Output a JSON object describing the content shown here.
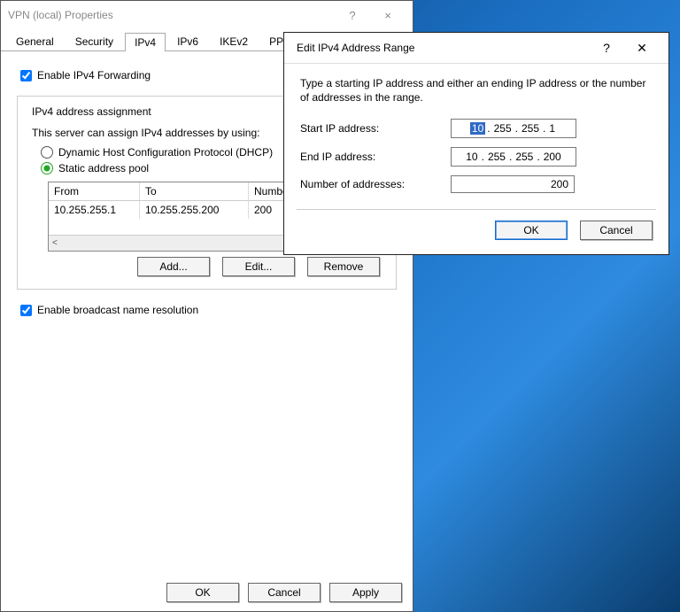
{
  "prop": {
    "title": "VPN (local) Properties",
    "help": "?",
    "close": "×",
    "tabs": [
      "General",
      "Security",
      "IPv4",
      "IPv6",
      "IKEv2",
      "PPP"
    ],
    "activeTab": "IPv4",
    "enableForwarding": "Enable IPv4 Forwarding",
    "groupTitle": "IPv4 address assignment",
    "groupDesc": "This server can assign IPv4 addresses by using:",
    "radioDhcp": "Dynamic Host Configuration Protocol (DHCP)",
    "radioStatic": "Static address pool",
    "tableHdr": {
      "from": "From",
      "to": "To",
      "number": "Number"
    },
    "tableRow": {
      "from": "10.255.255.1",
      "to": "10.255.255.200",
      "number": "200"
    },
    "btnAdd": "Add...",
    "btnEdit": "Edit...",
    "btnRemove": "Remove",
    "enableBroadcast": "Enable broadcast name resolution",
    "btnOk": "OK",
    "btnCancel": "Cancel",
    "btnApply": "Apply"
  },
  "dlg": {
    "title": "Edit IPv4 Address Range",
    "help": "?",
    "close": "✕",
    "desc": "Type a starting IP address and either an ending IP address or the number of addresses in the range.",
    "lblStart": "Start IP address:",
    "lblEnd": "End IP address:",
    "lblNum": "Number of addresses:",
    "startIP": {
      "o1": "10",
      "o2": "255",
      "o3": "255",
      "o4": "1"
    },
    "endIP": {
      "o1": "10",
      "o2": "255",
      "o3": "255",
      "o4": "200"
    },
    "number": "200",
    "btnOk": "OK",
    "btnCancel": "Cancel"
  }
}
